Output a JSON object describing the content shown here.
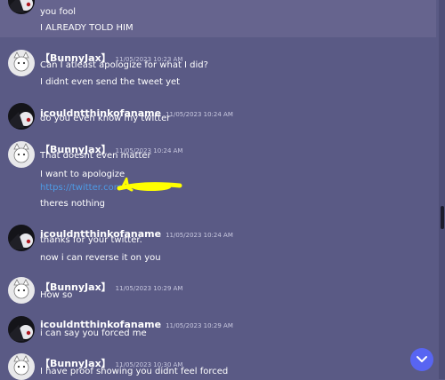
{
  "messages": [
    {
      "user": "",
      "time": "",
      "lines": [
        "you fool",
        "I ALREADY TOLD HIM"
      ]
    },
    {
      "user": "【BunnyJax】",
      "time": "11/05/2023 10:23 AM",
      "lines": [
        "Can I atleast apologize for what I did?",
        "I didnt even send the tweet yet"
      ]
    },
    {
      "user": "icouldntthinkofaname",
      "time": "11/05/2023 10:24 AM",
      "lines": [
        "do you even know my twitter"
      ]
    },
    {
      "user": "【BunnyJax】",
      "time": "11/05/2023 10:24 AM",
      "lines": [
        "That doesnt even matter",
        "I want to apologize",
        "https://twitter.com",
        "theres nothing"
      ]
    },
    {
      "user": "icouldntthinkofaname",
      "time": "11/05/2023 10:24 AM",
      "lines": [
        "thanks for your twitter.",
        "now i can reverse it on you"
      ]
    },
    {
      "user": "【BunnyJax】",
      "time": "11/05/2023 10:29 AM",
      "lines": [
        "How so"
      ]
    },
    {
      "user": "icouldntthinkofaname",
      "time": "11/05/2023 10:29 AM",
      "lines": [
        "i can say you forced me"
      ]
    },
    {
      "user": "【BunnyJax】",
      "time": "11/05/2023 10:30 AM",
      "lines": [
        "I have proof showing you didnt feel forced"
      ]
    }
  ],
  "colors": {
    "background": "#5a5a85",
    "highlight_row": "#66648e",
    "link": "#4d9be6",
    "redaction": "#ffff00",
    "jump_button": "#5865f2"
  },
  "icons": {
    "bunny_avatar": "cat-avatar-icon",
    "dark_avatar": "dark-character-avatar-icon",
    "jump": "chevron-down-icon"
  }
}
